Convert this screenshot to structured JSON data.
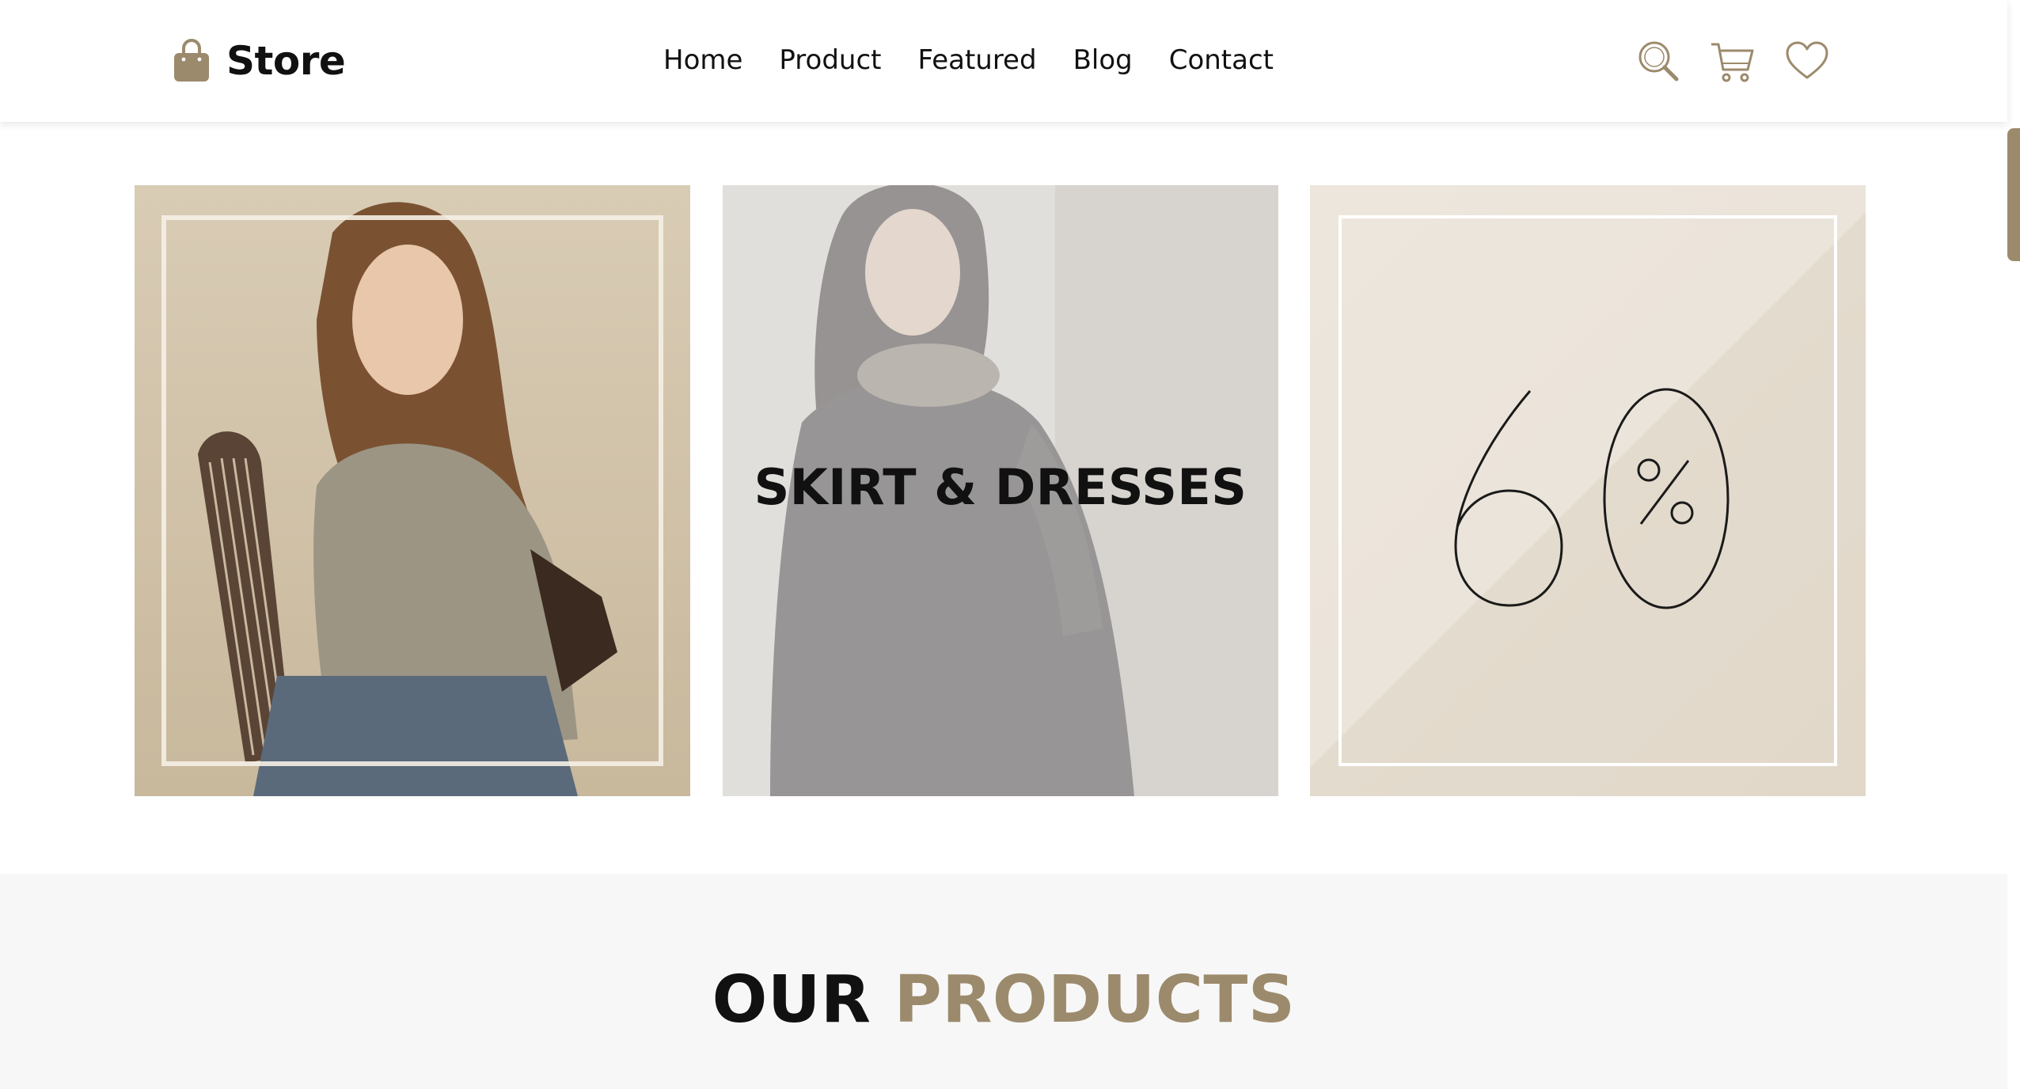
{
  "brand": {
    "name": "Store",
    "icon": "shopping-bag-icon",
    "accent_color": "#9c8a6c"
  },
  "nav": {
    "items": [
      {
        "label": "Home"
      },
      {
        "label": "Product"
      },
      {
        "label": "Featured"
      },
      {
        "label": "Blog"
      },
      {
        "label": "Contact"
      }
    ]
  },
  "header_icons": [
    "search-icon",
    "cart-icon",
    "heart-icon"
  ],
  "banners": [
    {
      "image": "woman-in-tshirt-photo"
    },
    {
      "image": "woman-in-black-dress-photo",
      "title": "SKIRT & DRESSES"
    },
    {
      "image": "sixty-percent-promo",
      "promo_number": "60",
      "promo_symbol": "%"
    }
  ],
  "products_section": {
    "title_part1": "OUR",
    "title_part2": "PRODUCTS"
  },
  "colors": {
    "accent": "#9c8a6c",
    "text": "#111111",
    "section_bg": "#f7f7f7",
    "promo_bg": "#e7e0d4"
  }
}
